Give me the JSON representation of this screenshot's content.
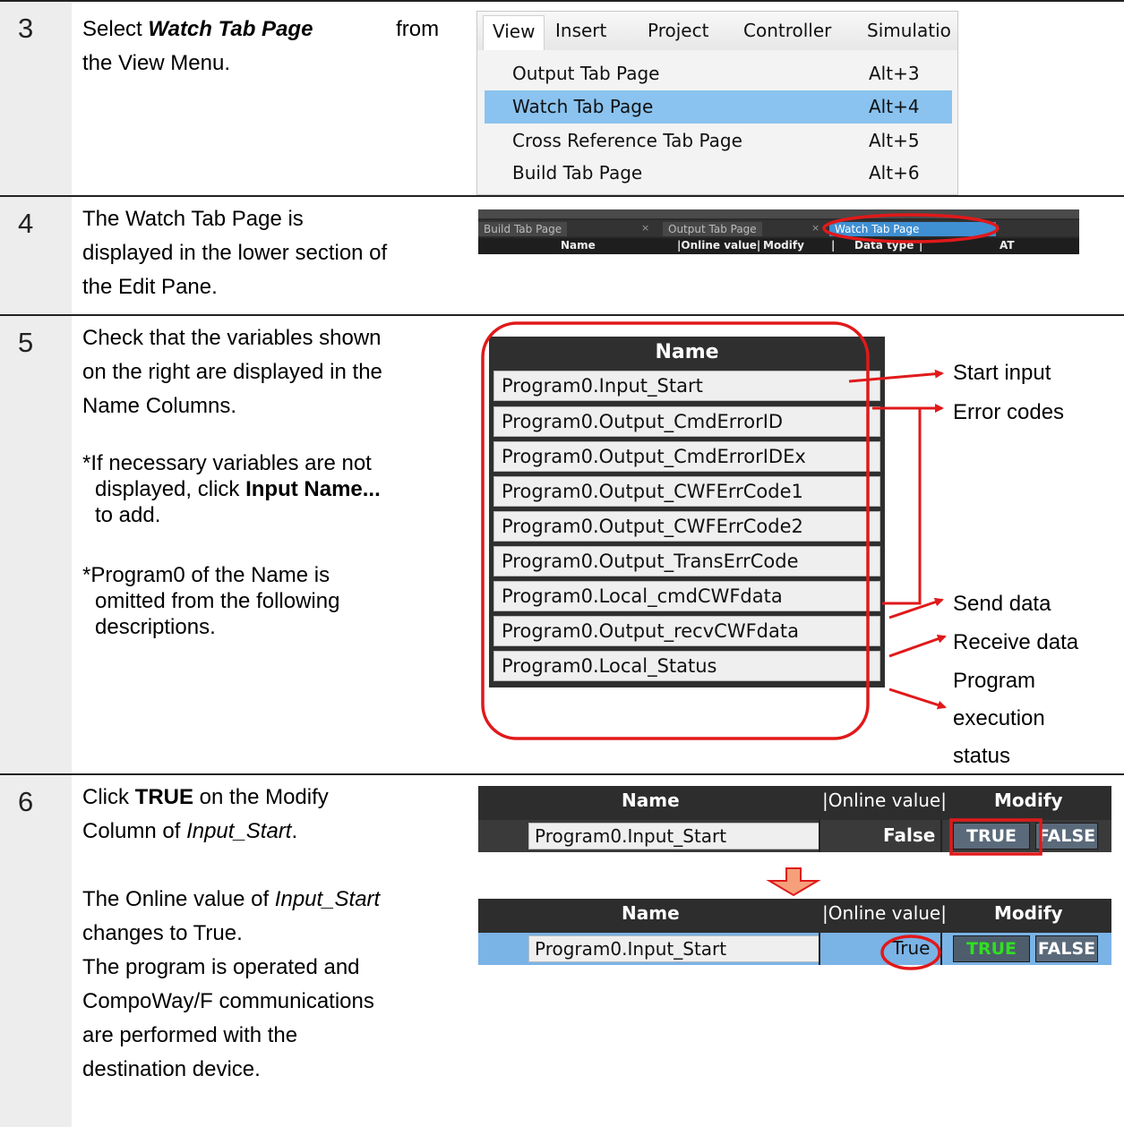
{
  "steps": [
    {
      "num": "3",
      "text_pre": "Select ",
      "text_em": "Watch Tab Page",
      "text_mid": " from",
      "text_post": "the View Menu.",
      "menu": {
        "bar": [
          "View",
          "Insert",
          "Project",
          "Controller",
          "Simulatio"
        ],
        "items": [
          {
            "label": "Output Tab Page",
            "key": "Alt+3"
          },
          {
            "label": "Watch Tab Page",
            "key": "Alt+4"
          },
          {
            "label": "Cross Reference Tab Page",
            "key": "Alt+5"
          },
          {
            "label": "Build Tab Page",
            "key": "Alt+6"
          }
        ]
      }
    },
    {
      "num": "4",
      "lines": [
        "The Watch Tab Page is",
        "displayed in the lower section of",
        "the Edit Pane."
      ],
      "tabs": [
        "Build Tab Page",
        "Output Tab Page",
        "Watch Tab Page"
      ],
      "tab_close": "×",
      "columns": [
        "Name",
        "|Online value|",
        "Modify",
        "|",
        "Data type",
        "|",
        "AT"
      ]
    },
    {
      "num": "5",
      "lines": [
        "Check that the variables shown",
        "on the right are displayed in the",
        "Name Columns."
      ],
      "note1": [
        "*If necessary variables are not",
        "displayed, click ",
        "Input Name...",
        "to add."
      ],
      "note2": [
        "*Program0 of the Name is",
        "omitted from the following",
        "descriptions."
      ],
      "name_header": "Name",
      "names": [
        "Program0.Input_Start",
        "Program0.Output_CmdErrorID",
        "Program0.Output_CmdErrorIDEx",
        "Program0.Output_CWFErrCode1",
        "Program0.Output_CWFErrCode2",
        "Program0.Output_TransErrCode",
        "Program0.Local_cmdCWFdata",
        "Program0.Output_recvCWFdata",
        "Program0.Local_Status"
      ],
      "callouts": [
        "Start input",
        "Error codes",
        "Send data",
        "Receive data",
        "Program",
        "execution",
        "status"
      ]
    },
    {
      "num": "6",
      "line1_pre": "Click ",
      "line1_bold": "TRUE",
      "line1_post": " on the Modify",
      "line2_pre": "Column of ",
      "line2_em": "Input_Start",
      "line2_post": ".",
      "para2": [
        "The Online value of ",
        "Input_Start",
        "changes to True."
      ],
      "para3": [
        "The program is operated and",
        "CompoWay/F communications",
        "are performed with the",
        "destination device."
      ],
      "watch": {
        "h_name": "Name",
        "h_online": "|Online value|",
        "h_modify": "Modify",
        "name": "Program0.Input_Start",
        "before_value": "False",
        "after_value": "True",
        "true_label": "TRUE",
        "false_label": "FALSE"
      }
    }
  ],
  "colors": {
    "highlight_red": "#e0191a",
    "menu_selected": "#8ac3ef",
    "arrow_orange": "#f5a07a"
  }
}
